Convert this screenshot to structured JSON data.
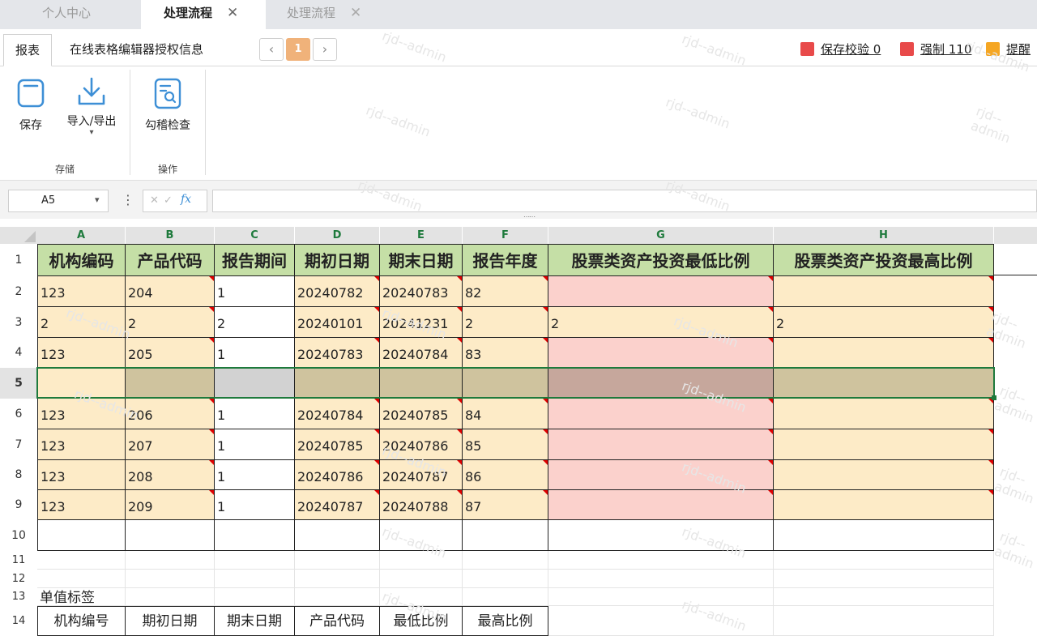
{
  "tabs": [
    {
      "label": "个人中心",
      "closable": false,
      "active": false
    },
    {
      "label": "处理流程",
      "closable": true,
      "active": true
    },
    {
      "label": "处理流程",
      "closable": true,
      "active": false
    }
  ],
  "close_glyph": "✕",
  "ribbon_tabs": [
    "报表",
    "在线表格编辑器授权信息"
  ],
  "pager": {
    "prev": "‹",
    "current": "1",
    "next": "›"
  },
  "legend": [
    {
      "label": "保存校验 0",
      "color": "#e84a4a"
    },
    {
      "label": "强制 110",
      "color": "#e84a4a"
    },
    {
      "label": "提醒",
      "color": "#f5a623"
    }
  ],
  "ribbon": {
    "save": "保存",
    "import_export": "导入/导出",
    "check": "勾稽检查",
    "group_storage": "存储",
    "group_operation": "操作",
    "dropdown_arrow": "▾"
  },
  "formula_bar": {
    "cell_ref": "A5",
    "cell_ref_arrow": "▾",
    "menu": "⋮",
    "cancel": "✕",
    "confirm": "✓",
    "fx": "fx",
    "value": ""
  },
  "grid_handle": "⋯⋯",
  "columns": [
    "A",
    "B",
    "C",
    "D",
    "E",
    "F",
    "G",
    "H"
  ],
  "row_numbers": [
    "1",
    "2",
    "3",
    "4",
    "5",
    "6",
    "7",
    "8",
    "9",
    "10",
    "11",
    "12",
    "13",
    "14"
  ],
  "headers": [
    "机构编码",
    "产品代码",
    "报告期间",
    "期初日期",
    "期末日期",
    "报告年度",
    "股票类资产投资最低比例",
    "股票类资产投资最高比例"
  ],
  "rows": [
    [
      "123",
      "204",
      "1",
      "20240782",
      "20240783",
      "82",
      "",
      ""
    ],
    [
      "2",
      "2",
      "2",
      "20240101",
      "20241231",
      "2",
      "2",
      "2"
    ],
    [
      "123",
      "205",
      "1",
      "20240783",
      "20240784",
      "83",
      "",
      ""
    ],
    [
      "",
      "",
      "",
      "",
      "",
      "",
      "",
      ""
    ],
    [
      "123",
      "206",
      "1",
      "20240784",
      "20240785",
      "84",
      "",
      ""
    ],
    [
      "123",
      "207",
      "1",
      "20240785",
      "20240786",
      "85",
      "",
      ""
    ],
    [
      "123",
      "208",
      "1",
      "20240786",
      "20240787",
      "86",
      "",
      ""
    ],
    [
      "123",
      "209",
      "1",
      "20240787",
      "20240788",
      "87",
      "",
      ""
    ],
    [
      "",
      "",
      "",
      "",
      "",
      "",
      "",
      ""
    ]
  ],
  "single_value_label": "单值标签",
  "footer_labels": [
    "机构编号",
    "期初日期",
    "期末日期",
    "产品代码",
    "最低比例",
    "最高比例"
  ],
  "watermark": "rjd--admin",
  "colors": {
    "header_green": "#c5dfa6",
    "cell_yellow": "#fdebc7",
    "cell_pink": "#fbd1cc",
    "selected_row": "#cfc39e",
    "accent_orange": "#f0b27a"
  }
}
